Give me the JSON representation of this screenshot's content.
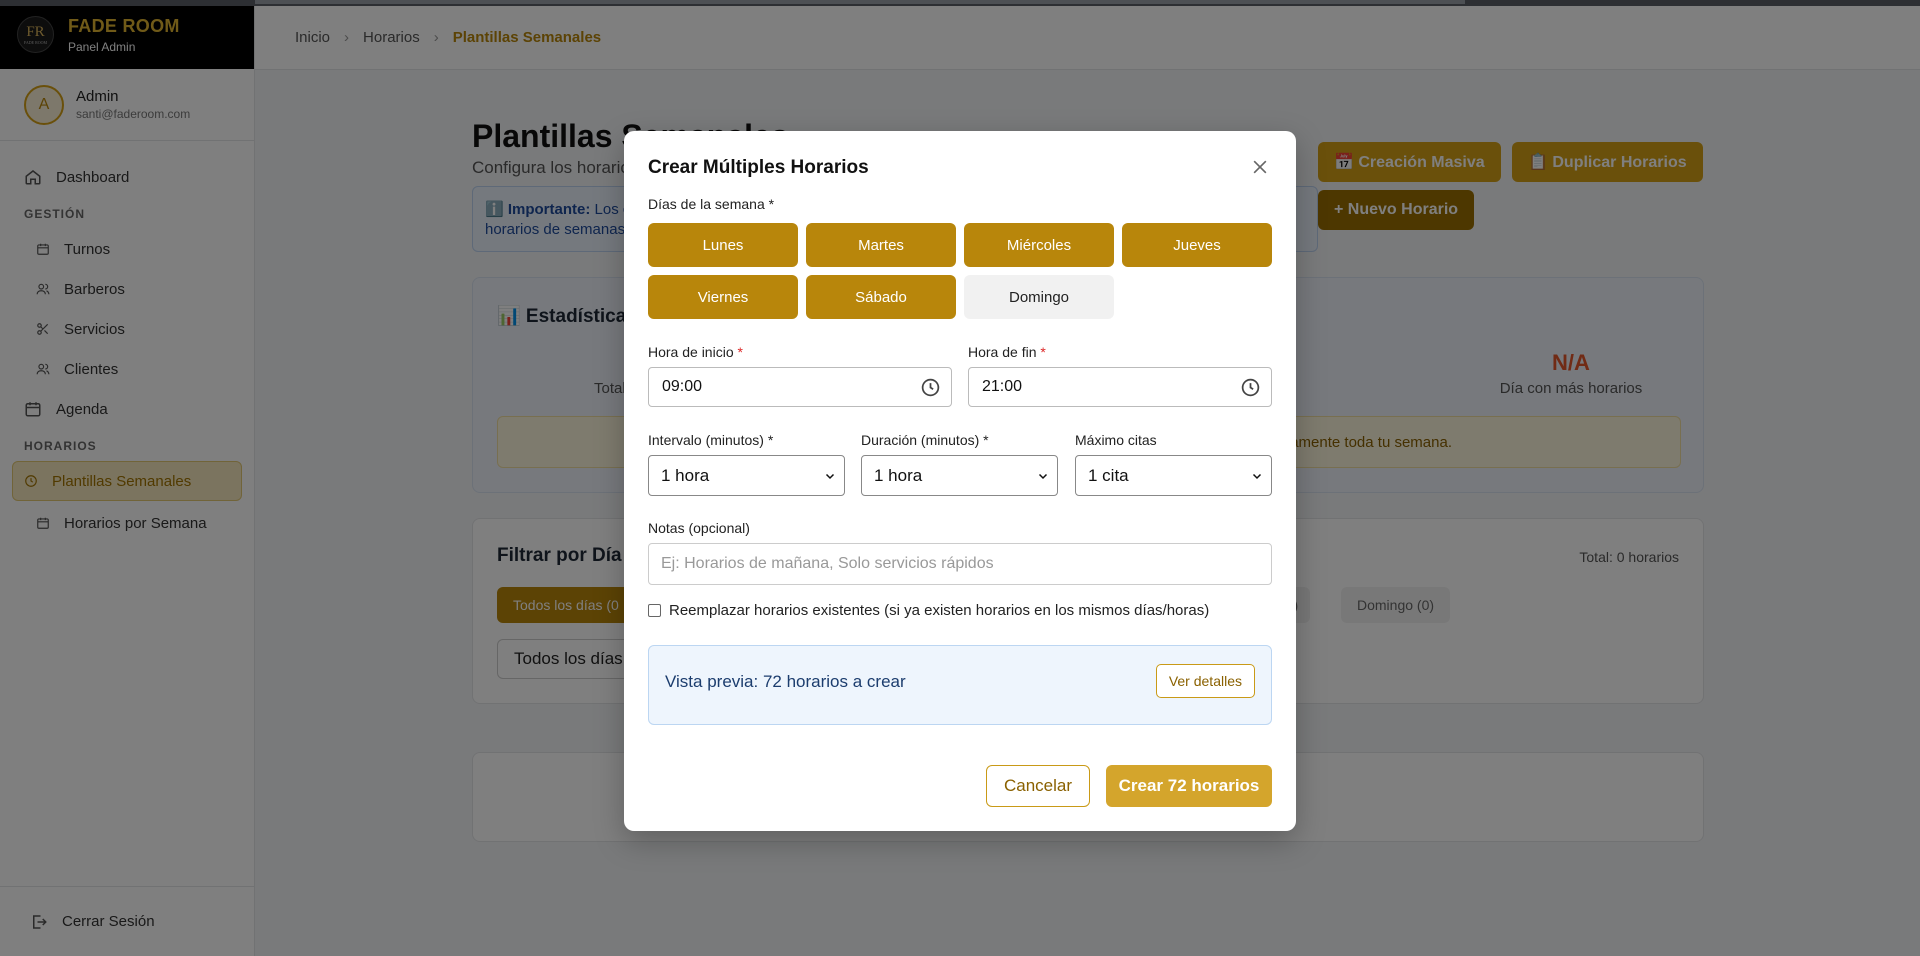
{
  "brand": {
    "logo_mark": "FR",
    "logo_small": "FADE ROOM",
    "name": "FADE ROOM",
    "subtitle": "Panel Admin"
  },
  "user": {
    "initial": "A",
    "name": "Admin",
    "email": "santi@faderoom.com"
  },
  "sidebar": {
    "dashboard": "Dashboard",
    "section_gestion": "GESTIÓN",
    "turnos": "Turnos",
    "barberos": "Barberos",
    "servicios": "Servicios",
    "clientes": "Clientes",
    "agenda": "Agenda",
    "section_horarios": "HORARIOS",
    "plantillas": "Plantillas Semanales",
    "horarios_semana": "Horarios por Semana",
    "logout": "Cerrar Sesión"
  },
  "breadcrumb": {
    "inicio": "Inicio",
    "horarios": "Horarios",
    "current": "Plantillas Semanales"
  },
  "page": {
    "title": "Plantillas Semanales",
    "subtitle": "Configura los horarios",
    "btn_masiva": "📅 Creación Masiva",
    "btn_duplicar": "📋 Duplicar Horarios",
    "btn_nuevo": "+ Nuevo Horario",
    "info_strong": "ℹ️ Importante:",
    "info_line1": "Los c",
    "info_line2": "horarios de semanas"
  },
  "stats": {
    "title": "📊 Estadísticas",
    "total_label": "Total",
    "na_value": "N/A",
    "na_label": "Día con más horarios",
    "tip": "amente toda tu semana."
  },
  "filter": {
    "title": "Filtrar por Día",
    "total": "Total: 0 horarios",
    "chip_all": "Todos los días (0",
    "chip_prev": "(0)",
    "chip_domingo": "Domingo (0)",
    "select_value": "Todos los días"
  },
  "modal": {
    "title": "Crear Múltiples Horarios",
    "days_label": "Días de la semana *",
    "days": [
      {
        "label": "Lunes",
        "selected": true
      },
      {
        "label": "Martes",
        "selected": true
      },
      {
        "label": "Miércoles",
        "selected": true
      },
      {
        "label": "Jueves",
        "selected": true
      },
      {
        "label": "Viernes",
        "selected": true
      },
      {
        "label": "Sábado",
        "selected": true
      },
      {
        "label": "Domingo",
        "selected": false
      }
    ],
    "start_label": "Hora de inicio",
    "start_value": "09:00",
    "end_label": "Hora de fin",
    "end_value": "21:00",
    "required_mark": "*",
    "interval_label": "Intervalo (minutos) *",
    "interval_value": "1 hora",
    "duration_label": "Duración (minutos) *",
    "duration_value": "1 hora",
    "max_label": "Máximo citas",
    "max_value": "1 cita",
    "notes_label": "Notas (opcional)",
    "notes_placeholder": "Ej: Horarios de mañana, Solo servicios rápidos",
    "replace_label": "Reemplazar horarios existentes (si ya existen horarios en los mismos días/horas)",
    "preview_text": "Vista previa: 72 horarios a crear",
    "preview_btn": "Ver detalles",
    "cancel": "Cancelar",
    "create": "Crear 72 horarios"
  },
  "colors": {
    "gold": "#d4a017",
    "gold_dark": "#b8860b",
    "overlay": "rgba(0,0,0,0.5)"
  }
}
